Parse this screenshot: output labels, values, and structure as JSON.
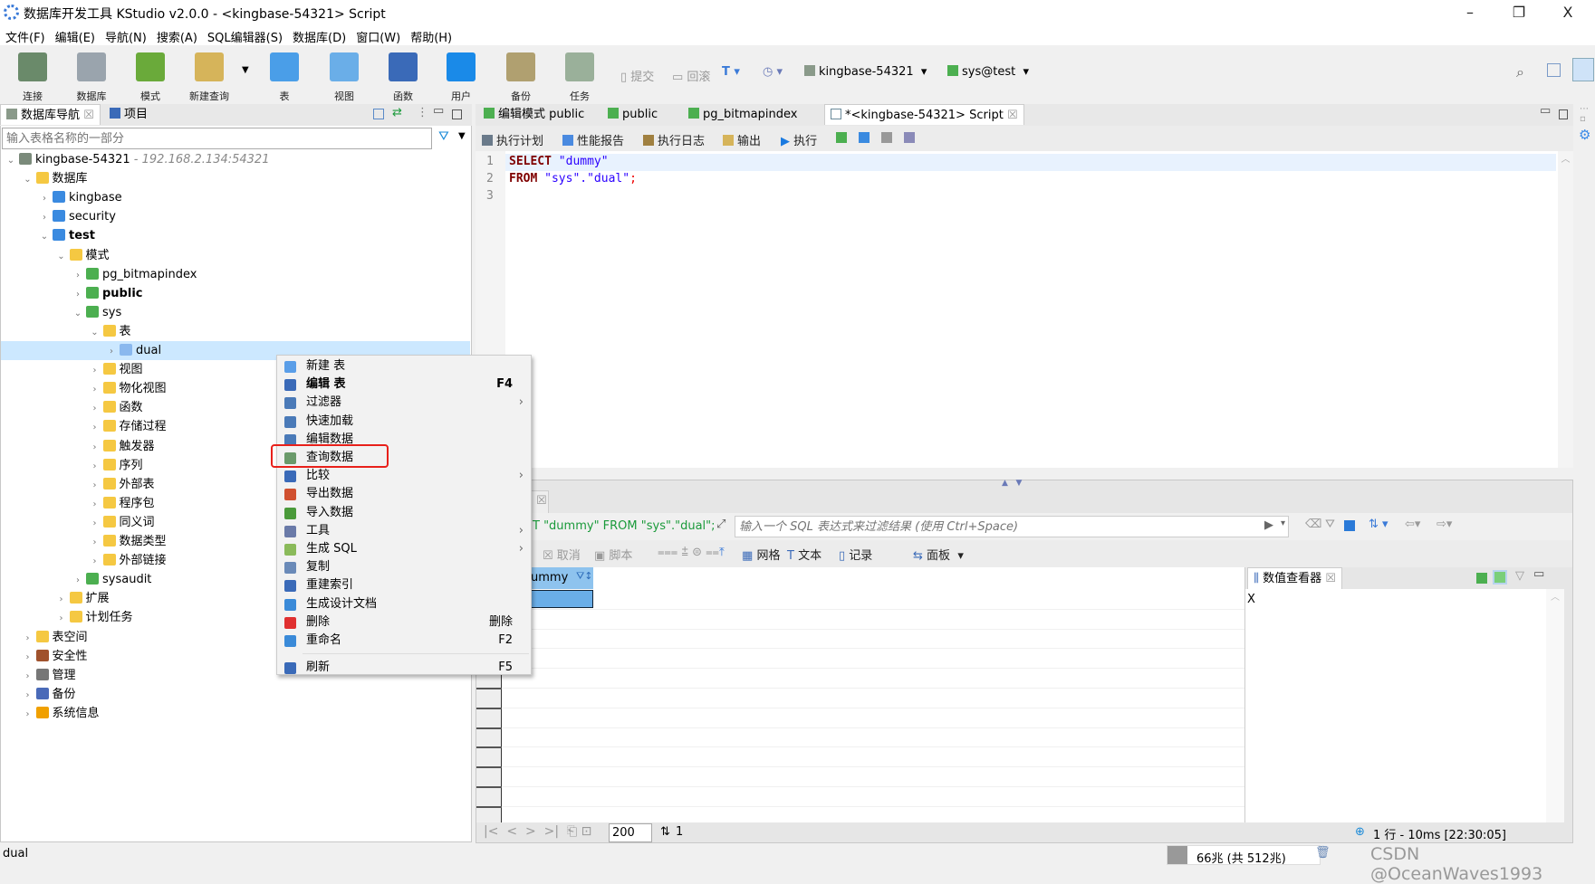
{
  "window": {
    "title": "数据库开发工具 KStudio v2.0.0 - <kingbase-54321> Script",
    "minimize": "–",
    "restore": "❐",
    "close": "X"
  },
  "menu": [
    "文件(F)",
    "编辑(E)",
    "导航(N)",
    "搜索(A)",
    "SQL编辑器(S)",
    "数据库(D)",
    "窗口(W)",
    "帮助(H)"
  ],
  "toolbar": {
    "buttons": [
      {
        "label": "连接",
        "icon": "connect-icon",
        "color": "#6a8a6a"
      },
      {
        "label": "数据库",
        "icon": "database-icon",
        "color": "#9aa4ad"
      },
      {
        "label": "模式",
        "icon": "schema-icon",
        "color": "#6aaa3a"
      },
      {
        "label": "新建查询",
        "icon": "new-query-icon",
        "color": "#d6b45a"
      },
      {
        "label": "表",
        "icon": "table-icon",
        "color": "#4a9ee8"
      },
      {
        "label": "视图",
        "icon": "view-icon",
        "color": "#6aaee8"
      },
      {
        "label": "函数",
        "icon": "function-icon",
        "color": "#3a6ab8"
      },
      {
        "label": "用户",
        "icon": "user-icon",
        "color": "#1a8ae8"
      },
      {
        "label": "备份",
        "icon": "backup-icon",
        "color": "#b0a070"
      },
      {
        "label": "任务",
        "icon": "task-icon",
        "color": "#9ab09a"
      }
    ],
    "commit": "提交",
    "rollback": "回滚",
    "connection": "kingbase-54321",
    "schema": "sys@test"
  },
  "navigator": {
    "tabs": [
      "数据库导航",
      "项目"
    ],
    "filter_placeholder": "输入表格名称的一部分",
    "tree": [
      {
        "label": "kingbase-54321",
        "sub": " - 192.168.2.134:54321",
        "depth": 0,
        "state": "open",
        "icon": "server",
        "color": "#7a8a7a"
      },
      {
        "label": "数据库",
        "depth": 1,
        "state": "open",
        "icon": "folder",
        "color": "#f5c842"
      },
      {
        "label": "kingbase",
        "depth": 2,
        "state": "closed",
        "icon": "database",
        "color": "#3a8ae0"
      },
      {
        "label": "security",
        "depth": 2,
        "state": "closed",
        "icon": "database",
        "color": "#3a8ae0"
      },
      {
        "label": "test",
        "depth": 2,
        "state": "open",
        "icon": "database",
        "color": "#3a8ae0",
        "bold": true
      },
      {
        "label": "模式",
        "depth": 3,
        "state": "open",
        "icon": "folder",
        "color": "#f5c842"
      },
      {
        "label": "pg_bitmapindex",
        "depth": 4,
        "state": "closed",
        "icon": "schema",
        "color": "#4caf50"
      },
      {
        "label": "public",
        "depth": 4,
        "state": "closed",
        "icon": "schema",
        "color": "#4caf50",
        "bold": true
      },
      {
        "label": "sys",
        "depth": 4,
        "state": "open",
        "icon": "schema",
        "color": "#4caf50"
      },
      {
        "label": "表",
        "depth": 5,
        "state": "open",
        "icon": "folder",
        "color": "#f5c842"
      },
      {
        "label": "dual",
        "depth": 6,
        "state": "closed",
        "icon": "table",
        "color": "#8ab8ee",
        "selected": true
      },
      {
        "label": "视图",
        "depth": 5,
        "state": "closed",
        "icon": "folder",
        "color": "#f5c842"
      },
      {
        "label": "物化视图",
        "depth": 5,
        "state": "closed",
        "icon": "folder",
        "color": "#f5c842"
      },
      {
        "label": "函数",
        "depth": 5,
        "state": "closed",
        "icon": "folder",
        "color": "#f5c842"
      },
      {
        "label": "存储过程",
        "depth": 5,
        "state": "closed",
        "icon": "folder",
        "color": "#f5c842"
      },
      {
        "label": "触发器",
        "depth": 5,
        "state": "closed",
        "icon": "folder",
        "color": "#f5c842"
      },
      {
        "label": "序列",
        "depth": 5,
        "state": "closed",
        "icon": "folder",
        "color": "#f5c842"
      },
      {
        "label": "外部表",
        "depth": 5,
        "state": "closed",
        "icon": "folder",
        "color": "#f5c842"
      },
      {
        "label": "程序包",
        "depth": 5,
        "state": "closed",
        "icon": "folder",
        "color": "#f5c842"
      },
      {
        "label": "同义词",
        "depth": 5,
        "state": "closed",
        "icon": "folder",
        "color": "#f5c842"
      },
      {
        "label": "数据类型",
        "depth": 5,
        "state": "closed",
        "icon": "folder",
        "color": "#f5c842"
      },
      {
        "label": "外部链接",
        "depth": 5,
        "state": "closed",
        "icon": "folder",
        "color": "#f5c842"
      },
      {
        "label": "sysaudit",
        "depth": 4,
        "state": "closed",
        "icon": "schema",
        "color": "#4caf50"
      },
      {
        "label": "扩展",
        "depth": 3,
        "state": "closed",
        "icon": "folder",
        "color": "#f5c842"
      },
      {
        "label": "计划任务",
        "depth": 3,
        "state": "closed",
        "icon": "folder",
        "color": "#f5c842"
      },
      {
        "label": "表空间",
        "depth": 1,
        "state": "closed",
        "icon": "folder",
        "color": "#f5c842"
      },
      {
        "label": "安全性",
        "depth": 1,
        "state": "closed",
        "icon": "security",
        "color": "#a0522d"
      },
      {
        "label": "管理",
        "depth": 1,
        "state": "closed",
        "icon": "gear",
        "color": "#777"
      },
      {
        "label": "备份",
        "depth": 1,
        "state": "closed",
        "icon": "layers",
        "color": "#4a6ab8"
      },
      {
        "label": "系统信息",
        "depth": 1,
        "state": "closed",
        "icon": "info",
        "color": "#f0a000"
      }
    ]
  },
  "editor": {
    "tabs": [
      "编辑模式 public",
      "public",
      "pg_bitmapindex",
      "*<kingbase-54321> Script"
    ],
    "toolbar": [
      "执行计划",
      "性能报告",
      "执行日志",
      "输出",
      "执行"
    ],
    "lines": [
      {
        "n": "1",
        "kw": "SELECT",
        "rest": " \"dummy\""
      },
      {
        "n": "2",
        "kw": "FROM",
        "rest": " \"sys\".\"dual\"",
        "end": ";"
      },
      {
        "n": "3",
        "kw": "",
        "rest": ""
      }
    ]
  },
  "context_menu": {
    "items": [
      {
        "label": "新建 表",
        "icon": "new-table-icon",
        "color": "#5a9ee8"
      },
      {
        "label": "编辑 表",
        "shortcut": "F4",
        "bold": true,
        "icon": "edit-icon",
        "color": "#3a6ab8"
      },
      {
        "label": "过滤器",
        "sub": true,
        "icon": "filter-icon",
        "color": "#4a7ab8"
      },
      {
        "label": "快速加载",
        "icon": "clock-icon",
        "color": "#4a7ab8"
      },
      {
        "label": "编辑数据",
        "icon": "edit-data-icon",
        "color": "#4a7ab8"
      },
      {
        "label": "查询数据",
        "icon": "query-data-icon",
        "color": "#6a9a6a",
        "highlight": true
      },
      {
        "label": "比较",
        "sub": true,
        "icon": "compare-icon",
        "color": "#3a6ab8"
      },
      {
        "label": "导出数据",
        "icon": "export-icon",
        "color": "#d05030"
      },
      {
        "label": "导入数据",
        "icon": "import-icon",
        "color": "#4a9a3a"
      },
      {
        "label": "工具",
        "sub": true,
        "icon": "wrench-icon",
        "color": "#6a7aa8"
      },
      {
        "label": "生成 SQL",
        "sub": true,
        "icon": "sql-icon",
        "color": "#8aba5a"
      },
      {
        "label": "复制",
        "icon": "copy-icon",
        "color": "#6a8ab8"
      },
      {
        "label": "重建索引",
        "icon": "reindex-icon",
        "color": "#3a6ab8"
      },
      {
        "label": "生成设计文档",
        "icon": "doc-icon",
        "color": "#3a8ad8"
      },
      {
        "label": "删除",
        "shortcut": "删除",
        "icon": "delete-icon",
        "color": "#e03030"
      },
      {
        "label": "重命名",
        "shortcut": "F2",
        "icon": "rename-icon",
        "color": "#3a8ad8"
      },
      {
        "label": "刷新",
        "shortcut": "F5",
        "icon": "refresh-icon",
        "color": "#3a6ab8",
        "separator_before": true
      }
    ]
  },
  "results": {
    "query_text": "T \"dummy\" FROM \"sys\".\"dual\";",
    "filter_placeholder": "输入一个 SQL 表达式来过滤结果 (使用 Ctrl+Space)",
    "toolbar": {
      "cancel": "取消",
      "script": "脚本",
      "grid": "网格",
      "text": "文本",
      "record": "记录",
      "panel": "面板"
    },
    "column_header": "ummy",
    "page_size": "200",
    "page": "1",
    "status": "1 行 - 10ms [22:30:05]"
  },
  "value_viewer": {
    "title": "数值查看器",
    "value": "X"
  },
  "statusbar": {
    "selection": "dual",
    "memory": "66兆 (共 512兆)",
    "memory_used_fraction": 0.129,
    "watermark": "CSDN @OceanWaves1993"
  }
}
